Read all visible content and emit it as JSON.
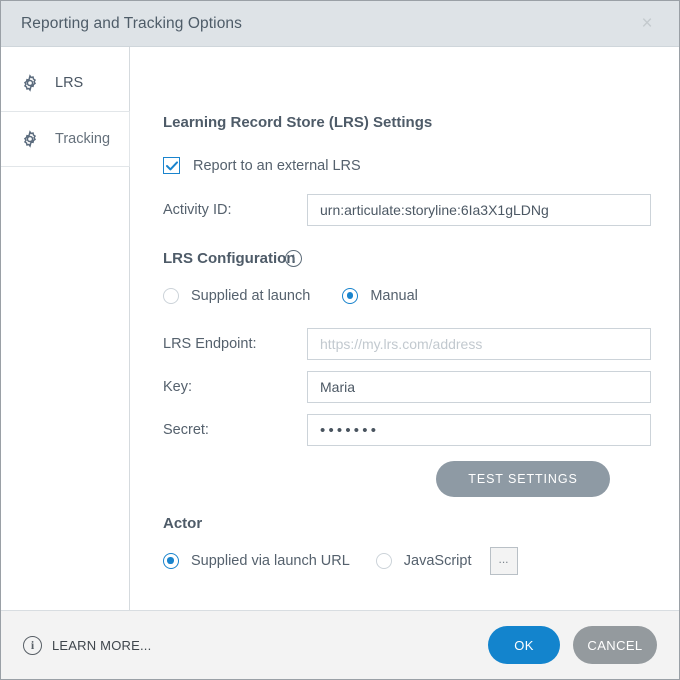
{
  "window": {
    "title": "Reporting and Tracking Options",
    "close_label": "×",
    "accent_color": "#1384cd",
    "titlebar_color": "#dee3e7"
  },
  "sidebar": {
    "items": [
      {
        "label": "LRS",
        "icon": "gear-icon",
        "selected": true
      },
      {
        "label": "Tracking",
        "icon": "gear-icon",
        "selected": false
      }
    ]
  },
  "main": {
    "section_heading": "Learning Record Store (LRS) Settings",
    "report_checkbox": {
      "label": "Report to an external LRS",
      "checked": true
    },
    "activity_id": {
      "label": "Activity ID:",
      "value": "urn:articulate:storyline:6Ia3X1gLDNg",
      "placeholder": ""
    },
    "lrs_configuration": {
      "heading": "LRS Configuration",
      "info_icon": "info-icon",
      "info_glyph": "i",
      "options": [
        {
          "label": "Supplied at launch",
          "selected": false
        },
        {
          "label": "Manual",
          "selected": true
        }
      ]
    },
    "lrs_endpoint": {
      "label": "LRS Endpoint:",
      "value": "",
      "placeholder": "https://my.lrs.com/address"
    },
    "key": {
      "label": "Key:",
      "value": "Maria",
      "placeholder": ""
    },
    "secret": {
      "label": "Secret:",
      "value": "•••••••",
      "placeholder": ""
    },
    "test_settings_label": "TEST SETTINGS",
    "actor": {
      "heading": "Actor",
      "options": [
        {
          "label": "Supplied via launch URL",
          "selected": true
        },
        {
          "label": "JavaScript",
          "selected": false
        }
      ],
      "browse_label": "..."
    }
  },
  "footer": {
    "learn_more_label": "LEARN MORE...",
    "learn_more_icon_glyph": "i",
    "ok_label": "OK",
    "cancel_label": "CANCEL"
  }
}
